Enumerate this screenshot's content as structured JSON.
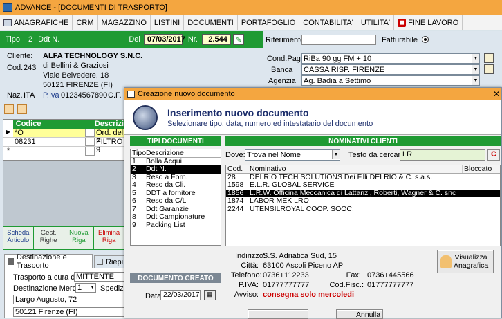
{
  "window": {
    "title": "ADVANCE - [DOCUMENTI DI TRASPORTO]"
  },
  "menu": {
    "items": [
      "ANAGRAFICHE",
      "CRM",
      "MAGAZZINO",
      "LISTINI",
      "DOCUMENTI",
      "PORTAFOGLIO",
      "CONTABILITA'",
      "UTILITA'",
      "FINE LAVORO"
    ]
  },
  "header": {
    "tipo_label": "Tipo",
    "tipo_value": "2",
    "tipo_name": "Ddt N.",
    "del_label": "Del",
    "date": "07/03/2017",
    "nr_label": "Nr.",
    "number": "2.544",
    "riferimento_label": "Riferimento",
    "fatturabile_label": "Fatturabile"
  },
  "client": {
    "cliente_label": "Cliente:",
    "cod_label": "Cod.",
    "cod": "243",
    "name": "ALFA TECHNOLOGY S.N.C.",
    "line2": "di Bellini &  Graziosi",
    "address": "Viale Belvedere, 18",
    "city": "50121 FIRENZE (FI)",
    "naz_label": "Naz.",
    "naz": "ITA",
    "piva_label": "P.Iva",
    "piva": "01234567890",
    "cf_label": "C.F."
  },
  "payment": {
    "condpag_label": "Cond.Pag.",
    "condpag": "RiBa 90 gg FM + 10",
    "banca_label": "Banca",
    "banca": "CASSA RISP. FIRENZE",
    "agenzia_label": "Agenzia",
    "agenzia": "Ag. Badia a Settimo"
  },
  "grid": {
    "col_codice": "Codice",
    "col_descr": "Descrizi",
    "rows": [
      {
        "code": "*O",
        "descr": "Ord. del 2"
      },
      {
        "code": "08231",
        "descr": "FILTRO 9"
      },
      {
        "code": "",
        "descr": ""
      }
    ],
    "row_markers": [
      "▶",
      "",
      "*"
    ]
  },
  "row_buttons": [
    {
      "l1": "Scheda",
      "l2": "Articolo"
    },
    {
      "l1": "Gest.",
      "l2": "Righe"
    },
    {
      "l1": "Nuova",
      "l2": "Riga"
    },
    {
      "l1": "Elimina",
      "l2": "Riga"
    }
  ],
  "bottom_tabs": {
    "tab1": "Destinazione e Trasporto",
    "tab2": "Riepi"
  },
  "transport": {
    "trasporto_label": "Trasporto a cura del",
    "trasporto": "MITTENTE",
    "dest_label": "Destinazione Merce",
    "dest_num": "1",
    "spediz_label": "Spediz.",
    "dest_addr": "Largo Augusto, 72",
    "dest_city": "50121 Firenze (FI)"
  },
  "dialog": {
    "title": "Creazione nuovo documento",
    "heading": "Inserimento nuovo documento",
    "subheading": "Selezionare tipo, data, numero ed intestatario del documento",
    "tipi_header": "TIPI DOCUMENTI",
    "tipo_col": "Tipo",
    "descr_col": "Descrizione",
    "tipi": [
      {
        "n": "1",
        "d": "Bolla Acqui."
      },
      {
        "n": "2",
        "d": "Ddt N."
      },
      {
        "n": "3",
        "d": "Reso a Forn."
      },
      {
        "n": "4",
        "d": "Reso da Cli."
      },
      {
        "n": "5",
        "d": "DDT a fornitore"
      },
      {
        "n": "6",
        "d": "Reso da C/L"
      },
      {
        "n": "7",
        "d": "Ddt Garanzie"
      },
      {
        "n": "8",
        "d": "Ddt Campionature"
      },
      {
        "n": "9",
        "d": "Packing List"
      }
    ],
    "tipi_selected": 1,
    "nominativi_header": "NOMINATIVI CLIENTI",
    "dove_label": "Dove:",
    "dove": "Trova nel Nome",
    "testo_label": "Testo da cercare:",
    "testo": "LR",
    "c_button": "C",
    "cod_col": "Cod.",
    "nom_col": "Nominativo",
    "blocc_col": "Bloccato",
    "clients": [
      {
        "cod": "28",
        "nome": "DELRIO TECH SOLUTIONS Dei F.lli DELRIO & C. s.a.s."
      },
      {
        "cod": "1598",
        "nome": "E.L.R. GLOBAL SERVICE"
      },
      {
        "cod": "1856",
        "nome": "L.R.W. Officina Meccanica di Lattanzi, Roberti, Wagner & C. snc"
      },
      {
        "cod": "1874",
        "nome": "LABOR MEK LRO"
      },
      {
        "cod": "2244",
        "nome": "UTENSILROYAL COOP. SOOC."
      }
    ],
    "clients_selected": 2,
    "detail": {
      "indirizzo_label": "Indirizzo:",
      "indirizzo": "S.S. Adriatica Sud, 15",
      "citta_label": "Città:",
      "citta": "63100 Ascoli Piceno AP",
      "telefono_label": "Telefono:",
      "telefono": "0736+112233",
      "fax_label": "Fax:",
      "fax": "0736+445566",
      "piva_label": "P.IVA:",
      "piva": "01777777777",
      "codfisc_label": "Cod.Fisc.:",
      "codfisc": "01777777777",
      "avviso_label": "Avviso:",
      "avviso": "consegna solo mercoledi"
    },
    "visualizza_l1": "Visualizza",
    "visualizza_l2": "Anagrafica",
    "doc_creato": "DOCUMENTO CREATO",
    "data_label": "Data",
    "data": "22/03/2017",
    "btn_annulla": "Annulla"
  },
  "colors": {
    "orange": "#f4a640",
    "green": "#1f9a33",
    "panel": "#dde6ee",
    "bluelabel": "#1b3a8a",
    "red": "#c00000"
  }
}
